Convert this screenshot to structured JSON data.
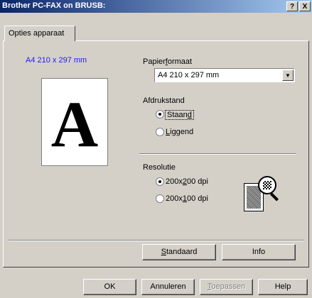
{
  "window": {
    "title": "Brother PC-FAX on BRUSB:",
    "help_button": "?",
    "close_button": "X"
  },
  "tab": {
    "label": "Opties apparaat"
  },
  "preview": {
    "paper_size_caption": "A4 210 x 297 mm",
    "sample_letter": "A"
  },
  "paper_format": {
    "label_pre": "Papier",
    "label_key": "f",
    "label_post": "ormaat",
    "selected": "A4 210 x 297 mm"
  },
  "orientation": {
    "label": "Afdrukstand",
    "options": [
      {
        "pre": "Staan",
        "key": "d",
        "post": "",
        "selected": true
      },
      {
        "pre": "",
        "key": "L",
        "post": "iggend",
        "selected": false
      }
    ]
  },
  "resolution": {
    "label": "Resolutie",
    "options": [
      {
        "pre": "200x",
        "key": "2",
        "post": "00 dpi",
        "selected": true
      },
      {
        "pre": "200x",
        "key": "1",
        "post": "00 dpi",
        "selected": false
      }
    ]
  },
  "panel_buttons": {
    "default": {
      "pre": "",
      "key": "S",
      "post": "tandaard"
    },
    "info": "Info"
  },
  "dialog_buttons": {
    "ok": "OK",
    "cancel": "Annuleren",
    "apply": {
      "pre": "",
      "key": "T",
      "post": "oepassen",
      "enabled": false
    },
    "help": "Help"
  }
}
